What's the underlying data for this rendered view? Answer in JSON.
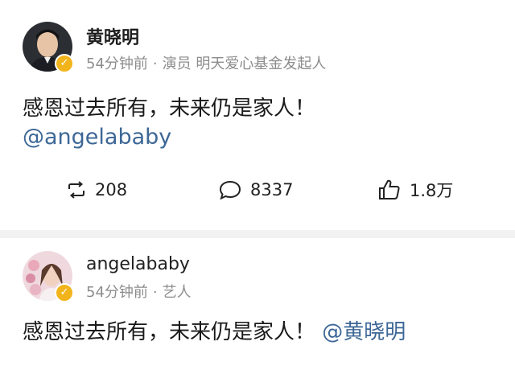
{
  "posts": [
    {
      "username": "黄晓明",
      "time": "54分钟前",
      "separator": "·",
      "description": "演员 明天爱心基金发起人",
      "content_text": "感恩过去所有，未来仍是家人！",
      "mention": "@angelababy",
      "actions": {
        "reposts": "208",
        "comments": "8337",
        "likes": "1.8万"
      }
    },
    {
      "username": "angelababy",
      "time": "54分钟前",
      "separator": "·",
      "description": "艺人",
      "content_text": "感恩过去所有，未来仍是家人！",
      "mention": "@黄晓明"
    }
  ],
  "colors": {
    "mention": "#3d6796",
    "meta": "#8c8c8c",
    "verified_badge": "#f2b41b"
  },
  "icons": {
    "verified": "verified-badge-icon",
    "repost": "repost-icon",
    "comment": "comment-icon",
    "like": "like-icon"
  }
}
